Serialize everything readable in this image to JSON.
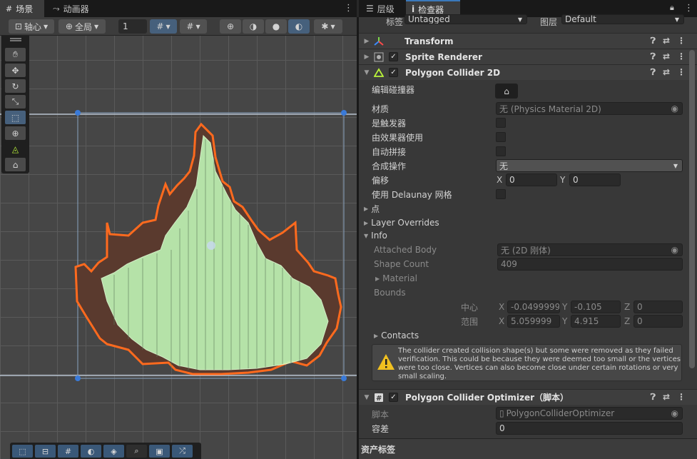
{
  "tabs_left": [
    {
      "label": "场景",
      "icon": "grid-icon",
      "active": true
    },
    {
      "label": "动画器",
      "icon": "animator-icon",
      "active": false
    }
  ],
  "tabs_right": [
    {
      "label": "层级",
      "icon": "hierarchy-icon",
      "active": false
    },
    {
      "label": "检查器",
      "icon": "info-icon",
      "active": true
    }
  ],
  "scene_toolbar": {
    "pivot_label": "轴心",
    "global_label": "全局",
    "grid_size": "1"
  },
  "inspector": {
    "tag_label": "标签",
    "tag_value": "Untagged",
    "layer_label": "图层",
    "layer_value": "Default",
    "components": [
      {
        "name": "Transform",
        "icon": "transform-icon",
        "expanded": false,
        "has_checkbox": false
      },
      {
        "name": "Sprite Renderer",
        "icon": "sprite-renderer-icon",
        "expanded": false,
        "has_checkbox": true
      },
      {
        "name": "Polygon Collider 2D",
        "icon": "polygon-collider-icon",
        "expanded": true,
        "has_checkbox": true
      }
    ],
    "collider": {
      "edit_label": "编辑碰撞器",
      "material_label": "材质",
      "material_value": "无 (Physics Material 2D)",
      "trigger_label": "是触发器",
      "effector_label": "由效果器使用",
      "autotiling_label": "自动拼接",
      "composite_label": "合成操作",
      "composite_value": "无",
      "offset_label": "偏移",
      "offset_x": "0",
      "offset_y": "0",
      "delaunay_label": "使用 Delaunay 网格",
      "points_label": "点",
      "layer_overrides_label": "Layer Overrides",
      "info_label": "Info",
      "attached_body_label": "Attached Body",
      "attached_body_value": "无 (2D 刚体)",
      "shape_count_label": "Shape Count",
      "shape_count_value": "409",
      "material_info_label": "Material",
      "bounds_label": "Bounds",
      "center_label": "中心",
      "center_x": "-0.0499999",
      "center_y": "-0.105",
      "center_z": "0",
      "extents_label": "范围",
      "extents_x": "5.059999",
      "extents_y": "4.915",
      "extents_z": "0",
      "contacts_label": "Contacts",
      "warning_text": "The collider created collision shape(s) but some were removed as they failed verification.  This could be because they were deemed too small or the vertices were too close.  Vertices can also become close under certain rotations or very small scaling."
    },
    "optimizer": {
      "name": "Polygon Collider Optimizer（脚本）",
      "script_label": "脚本",
      "script_value": "PolygonColliderOptimizer",
      "tolerance_label": "容差",
      "tolerance_value": "0"
    },
    "asset_labels": "资产标签"
  },
  "axes": {
    "x": "X",
    "y": "Y",
    "z": "Z"
  }
}
